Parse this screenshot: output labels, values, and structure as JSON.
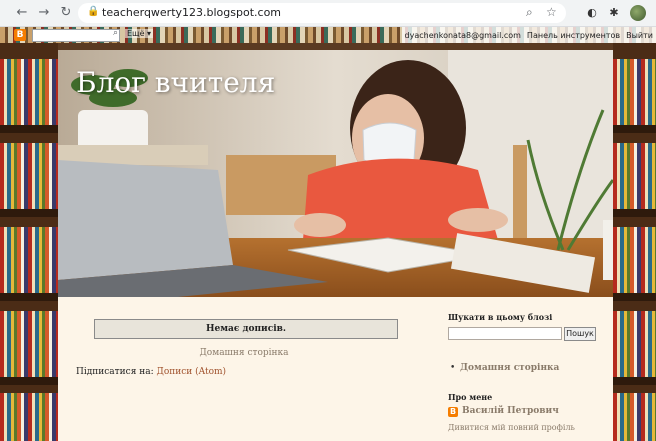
{
  "browser": {
    "url": "teacherqwerty123.blogspot.com"
  },
  "navbar": {
    "logo": "B",
    "more": "Ещё ▾",
    "email": "dyachenkonata8@gmail.com",
    "dashboard": "Панель инструментов",
    "signout": "Выйти"
  },
  "blog": {
    "title": "Блог вчителя"
  },
  "main": {
    "no_posts": "Немає дописів.",
    "home_link": "Домашня сторінка",
    "subscribe_label": "Підписатися на:",
    "subscribe_link": "Дописи (Atom)"
  },
  "sidebar": {
    "search_title": "Шукати в цьому блозі",
    "search_button": "Пошук",
    "pages_link": "Домашня сторінка",
    "about_title": "Про мене",
    "profile_name": "Василій Петрович",
    "profile_link": "Дивитися мій повний профіль"
  }
}
